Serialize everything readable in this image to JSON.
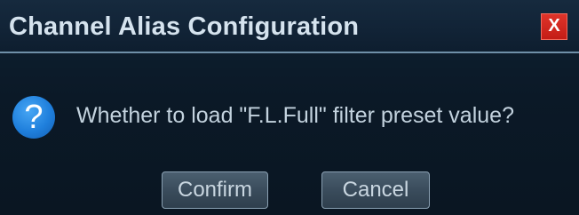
{
  "dialog": {
    "title": "Channel Alias Configuration",
    "close_label": "X",
    "icon": "question-icon",
    "icon_glyph": "?",
    "message": "Whether to load \"F.L.Full\" filter preset value?",
    "buttons": {
      "confirm_label": "Confirm",
      "cancel_label": "Cancel"
    }
  },
  "colors": {
    "background": "#0c1a2a",
    "title_text": "#d5e3ee",
    "close_button": "#d42a21",
    "icon_blue": "#1f7fdc",
    "button_face": "#3a4c5c"
  }
}
